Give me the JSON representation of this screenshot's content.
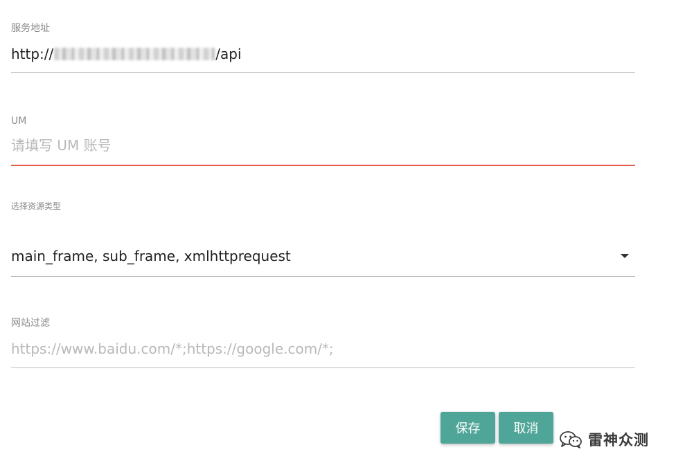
{
  "form": {
    "service": {
      "label": "服务地址",
      "value_prefix": "http://",
      "value_suffix": "/api"
    },
    "um": {
      "label": "UM",
      "placeholder": "请填写 UM 账号",
      "value": ""
    },
    "resource_type": {
      "label": "选择资源类型",
      "selected": "main_frame, sub_frame, xmlhttprequest"
    },
    "site_filter": {
      "label": "网站过滤",
      "placeholder": "https://www.baidu.com/*;https://google.com/*;",
      "value": ""
    }
  },
  "actions": {
    "save_label": "保存",
    "cancel_label": "取消"
  },
  "watermark": {
    "text": "雷神众测",
    "icon": "wechat-icon"
  },
  "colors": {
    "accent": "#4fa597",
    "error": "#e4584a",
    "divider": "#bdbdbd",
    "placeholder": "#b8b8b8"
  }
}
